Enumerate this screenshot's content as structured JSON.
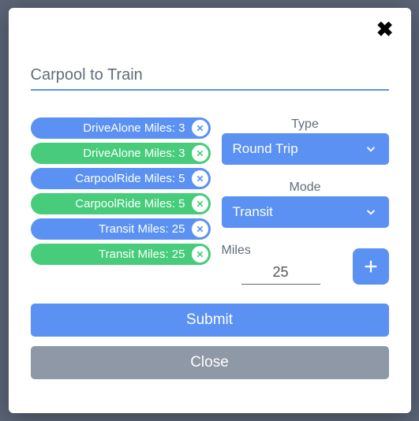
{
  "title": "Carpool to Train",
  "chips": [
    {
      "label": "DriveAlone Miles: 3",
      "color": "blue"
    },
    {
      "label": "DriveAlone Miles: 3",
      "color": "green"
    },
    {
      "label": "CarpoolRide Miles: 5",
      "color": "blue"
    },
    {
      "label": "CarpoolRide Miles: 5",
      "color": "green"
    },
    {
      "label": "Transit Miles: 25",
      "color": "blue"
    },
    {
      "label": "Transit Miles: 25",
      "color": "green"
    }
  ],
  "form": {
    "type_label": "Type",
    "type_value": "Round Trip",
    "mode_label": "Mode",
    "mode_value": "Transit",
    "miles_label": "Miles",
    "miles_value": "25"
  },
  "buttons": {
    "submit": "Submit",
    "close": "Close"
  }
}
